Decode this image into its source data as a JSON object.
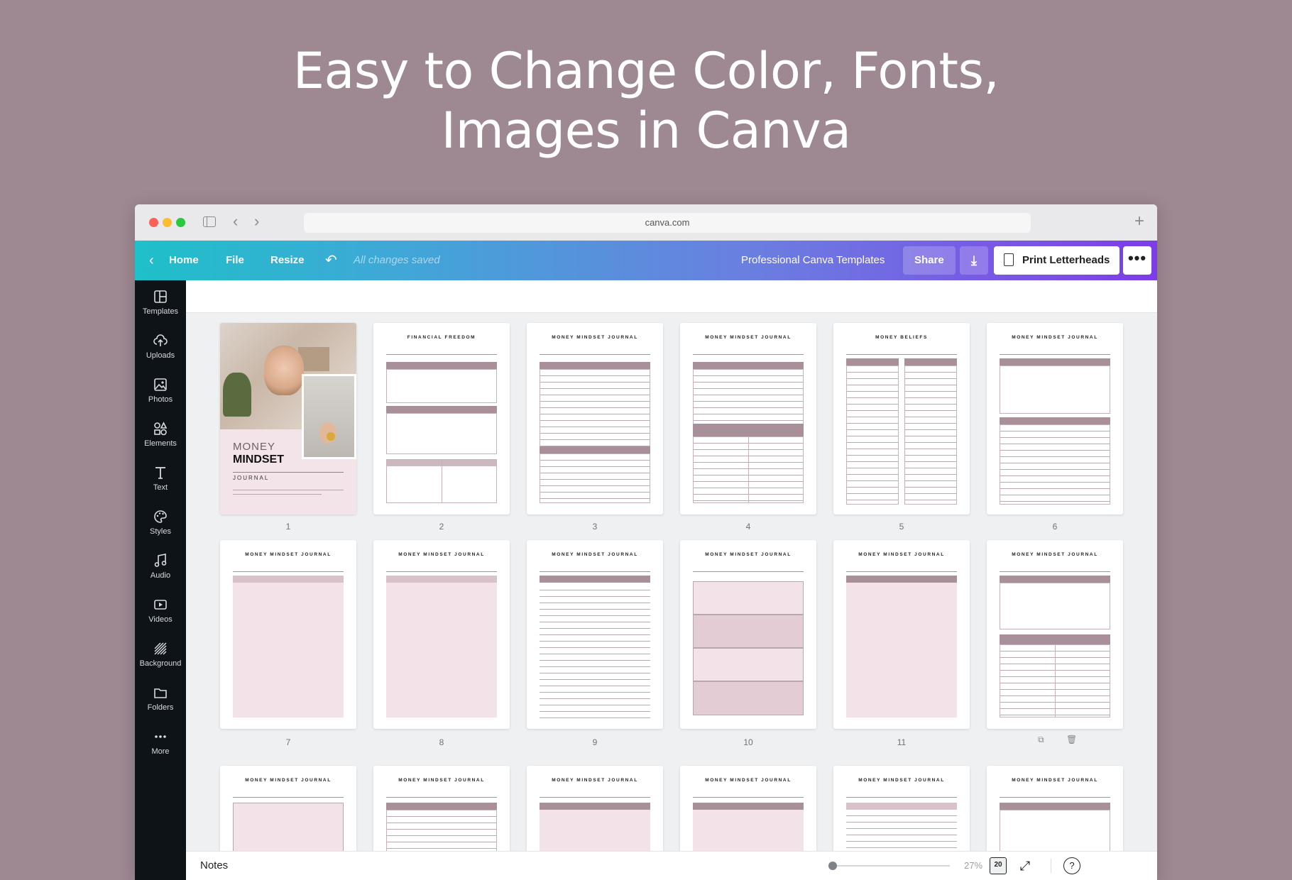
{
  "hero": {
    "line1": "Easy to Change Color, Fonts,",
    "line2": "Images in Canva"
  },
  "browser": {
    "url": "canva.com"
  },
  "toolbar": {
    "home": "Home",
    "file": "File",
    "resize": "Resize",
    "saved": "All changes saved",
    "title": "Professional Canva Templates",
    "share": "Share",
    "print": "Print Letterheads",
    "more": "•••"
  },
  "sidebar": {
    "items": [
      {
        "label": "Templates",
        "icon": "templates-icon"
      },
      {
        "label": "Uploads",
        "icon": "upload-cloud-icon"
      },
      {
        "label": "Photos",
        "icon": "photo-icon"
      },
      {
        "label": "Elements",
        "icon": "shapes-icon"
      },
      {
        "label": "Text",
        "icon": "text-icon"
      },
      {
        "label": "Styles",
        "icon": "palette-icon"
      },
      {
        "label": "Audio",
        "icon": "music-note-icon"
      },
      {
        "label": "Videos",
        "icon": "video-icon"
      },
      {
        "label": "Background",
        "icon": "background-pattern-icon"
      },
      {
        "label": "Folders",
        "icon": "folder-icon"
      },
      {
        "label": "More",
        "icon": "more-dots-icon"
      }
    ]
  },
  "pages": [
    {
      "num": "1",
      "title": ""
    },
    {
      "num": "2",
      "title": "FINANCIAL FREEDOM"
    },
    {
      "num": "3",
      "title": "MONEY MINDSET JOURNAL"
    },
    {
      "num": "4",
      "title": "MONEY MINDSET JOURNAL"
    },
    {
      "num": "5",
      "title": "MONEY BELIEFS"
    },
    {
      "num": "6",
      "title": "MONEY MINDSET JOURNAL"
    },
    {
      "num": "7",
      "title": "MONEY MINDSET JOURNAL"
    },
    {
      "num": "8",
      "title": "MONEY MINDSET JOURNAL"
    },
    {
      "num": "9",
      "title": "MONEY MINDSET JOURNAL"
    },
    {
      "num": "10",
      "title": "MONEY MINDSET JOURNAL"
    },
    {
      "num": "11",
      "title": "MONEY MINDSET JOURNAL"
    },
    {
      "num": "",
      "title": "MONEY MINDSET JOURNAL"
    },
    {
      "num": "",
      "title": "MONEY MINDSET JOURNAL"
    },
    {
      "num": "",
      "title": "MONEY MINDSET JOURNAL"
    },
    {
      "num": "",
      "title": "MONEY MINDSET JOURNAL"
    },
    {
      "num": "",
      "title": "MONEY MINDSET JOURNAL"
    },
    {
      "num": "",
      "title": "MONEY MINDSET JOURNAL"
    },
    {
      "num": "",
      "title": "MONEY MINDSET JOURNAL"
    }
  ],
  "cover": {
    "money": "MONEY",
    "mindset": "MINDSET",
    "journal": "JOURNAL"
  },
  "footer": {
    "notes": "Notes",
    "zoom": "27%",
    "page_count": "20",
    "zoom_level": 0.27
  }
}
